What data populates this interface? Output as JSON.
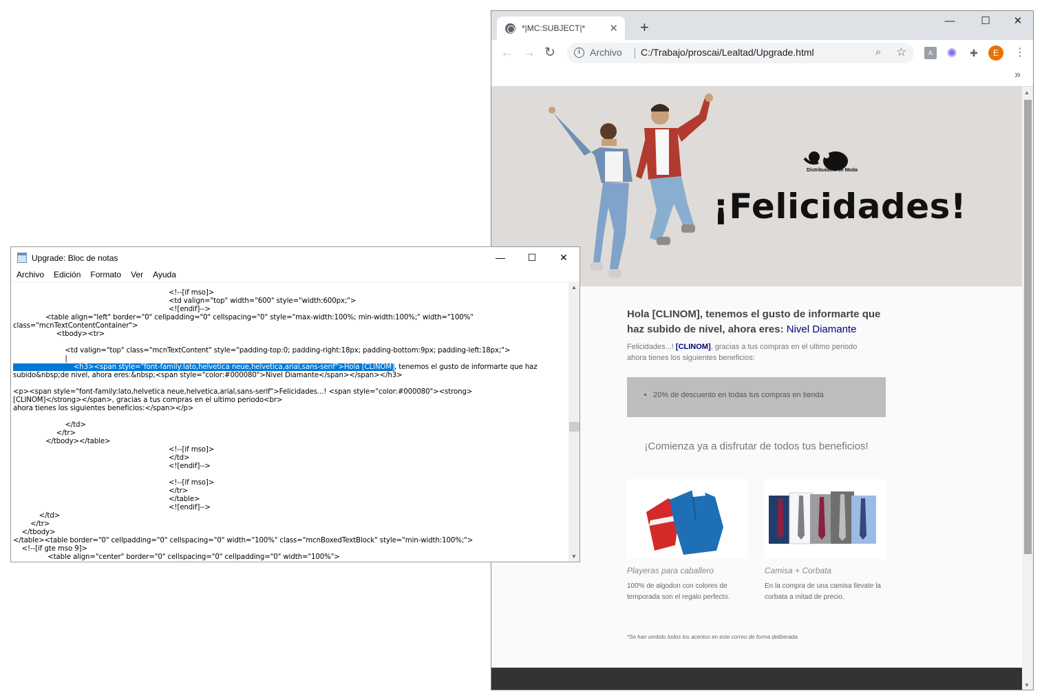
{
  "browser": {
    "tab_title": "*|MC:SUBJECT|*",
    "tab_close": "✕",
    "new_tab": "+",
    "scheme_label": "Archivo",
    "url": "C:/Trabajo/proscai/Lealtad/Upgrade.html",
    "avatar_letter": "E",
    "icons": [
      "globe-icon",
      "back-icon",
      "forward-icon",
      "reload-icon",
      "info-icon",
      "zoom-icon",
      "star-icon",
      "pdf-icon",
      "extension-star-icon",
      "puzzle-icon",
      "menu-dots-icon",
      "chevron-right-icon"
    ]
  },
  "email": {
    "brand_name": "Distribuidora de Moda",
    "hero_title": "¡Felicidades!",
    "greeting_heading_pre": "Hola [CLINOM], tenemos el gusto de informarte que haz subido de nivel, ahora eres: ",
    "nivel": "Nivel Diamante",
    "greeting_p_pre": "Felicidades...! ",
    "greeting_p_client": "[CLINOM]",
    "greeting_p_post": ", gracias a tus compras en el ultimo periodo",
    "greeting_p_line2": "ahora tienes los siguientes beneficios:",
    "benefits": [
      "20% de descuento en todas tus compras en tienda"
    ],
    "cta": "¡Comienza ya a disfrutar de todos tus beneficios!",
    "products": [
      {
        "title": "Playeras para caballero",
        "desc": "100% de algodon con colores de temporada son el regalo perfecto."
      },
      {
        "title": "Camisa + Corbata",
        "desc": "En la compra de una camisa llevate la corbata a mitad de precio."
      }
    ],
    "footnote": "*Se han omitido todos los acentos en este correo de forma deliberada."
  },
  "notepad": {
    "title": "Upgrade: Bloc de notas",
    "menu": [
      "Archivo",
      "Edición",
      "Formato",
      "Ver",
      "Ayuda"
    ],
    "lines_a": [
      "                                                                        <!--[if mso]>",
      "                                                                        <td valign=\"top\" width=\"600\" style=\"width:600px;\">",
      "                                                                        <![endif]-->",
      "               <table align=\"left\" border=\"0\" cellpadding=\"0\" cellspacing=\"0\" style=\"max-width:100%; min-width:100%;\" width=\"100%\"",
      "class=\"mcnTextContentContainer\">",
      "                    <tbody><tr>",
      "",
      "                        <td valign=\"top\" class=\"mcnTextContent\" style=\"padding-top:0; padding-right:18px; padding-bottom:9px; padding-left:18px;\">",
      "                        |"
    ],
    "selected_text": "                            <h3><span style=\"font-family:lato,helvetica neue,helvetica,arial,sans-serif\">Hola [CLINOM]",
    "after_selected": ", tenemos el gusto de informarte que haz",
    "lines_b": [
      "subido&nbsp;de nivel, ahora eres:&nbsp;<span style=\"color:#000080\">Nivel Diamante</span></span></h3>",
      "",
      "<p><span style=\"font-family:lato,helvetica neue,helvetica,arial,sans-serif\">Felicidades...! <span style=\"color:#000080\"><strong>",
      "[CLINOM]</strong></span>, gracias a tus compras en el ultimo periodo<br>",
      "ahora tienes los siguientes beneficios:</span></p>",
      "",
      "                        </td>",
      "                    </tr>",
      "               </tbody></table>",
      "                                                                        <!--[if mso]>",
      "                                                                        </td>",
      "                                                                        <![endif]-->",
      "",
      "                                                                        <!--[if mso]>",
      "                                                                        </tr>",
      "                                                                        </table>",
      "                                                                        <![endif]-->",
      "            </td>",
      "        </tr>",
      "    </tbody>",
      "</table><table border=\"0\" cellpadding=\"0\" cellspacing=\"0\" width=\"100%\" class=\"mcnBoxedTextBlock\" style=\"min-width:100%;\">",
      "    <!--[if gte mso 9]>",
      "                <table align=\"center\" border=\"0\" cellspacing=\"0\" cellpadding=\"0\" width=\"100%\">"
    ]
  },
  "colors": {
    "nivel": "#000080",
    "selection": "#0078d7",
    "hero_bg": "#dedbd8",
    "benefits_bg": "#bdbdbd",
    "avatar": "#e8710a"
  }
}
